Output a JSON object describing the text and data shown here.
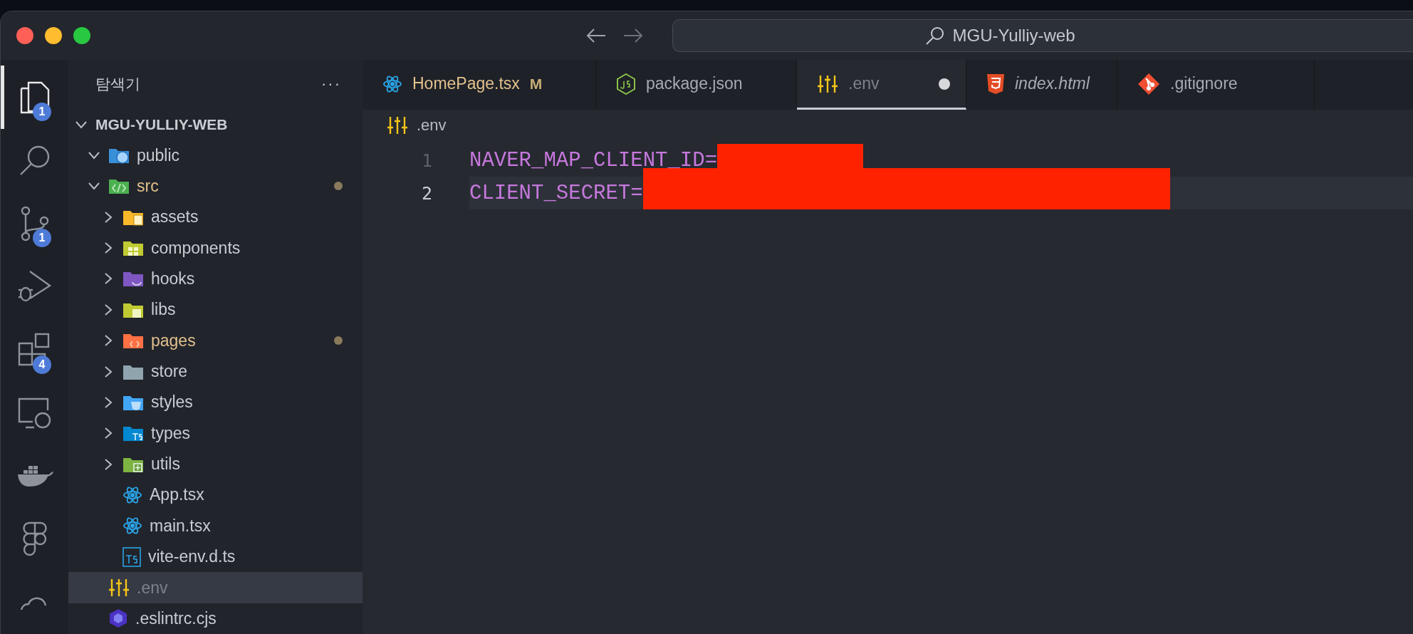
{
  "window": {
    "title": "MGU-Yulliy-web"
  },
  "activity_bar": [
    {
      "kind": "files",
      "selected": true,
      "badge": "1"
    },
    {
      "kind": "search",
      "selected": false
    },
    {
      "kind": "git",
      "selected": false,
      "badge": "1"
    },
    {
      "kind": "debug",
      "selected": false
    },
    {
      "kind": "extensions",
      "selected": false,
      "badge": "4"
    },
    {
      "kind": "remote",
      "selected": false
    },
    {
      "kind": "docker",
      "selected": false
    },
    {
      "kind": "figma",
      "selected": false
    },
    {
      "kind": "cloud",
      "selected": false
    }
  ],
  "sidebar": {
    "title": "탐색기",
    "more": "···",
    "root": {
      "label": "MGU-YULLIY-WEB",
      "expanded": true
    },
    "items": [
      {
        "label": "public",
        "kind": "folder-web",
        "expanded": true,
        "modified": false,
        "selected": false
      },
      {
        "label": "src",
        "kind": "folder-src",
        "expanded": true,
        "modified": true,
        "selected": false,
        "children": [
          {
            "label": "assets",
            "kind": "folder-assets",
            "expanded": false,
            "modified": false,
            "selected": false
          },
          {
            "label": "components",
            "kind": "folder-components",
            "expanded": false,
            "modified": false,
            "selected": false
          },
          {
            "label": "hooks",
            "kind": "folder-hooks",
            "expanded": false,
            "modified": false,
            "selected": false
          },
          {
            "label": "libs",
            "kind": "folder-libs",
            "expanded": false,
            "modified": false,
            "selected": false
          },
          {
            "label": "pages",
            "kind": "folder-pages",
            "expanded": false,
            "modified": true,
            "selected": false
          },
          {
            "label": "store",
            "kind": "folder-store",
            "expanded": false,
            "modified": false,
            "selected": false
          },
          {
            "label": "styles",
            "kind": "folder-styles",
            "expanded": false,
            "modified": false,
            "selected": false
          },
          {
            "label": "types",
            "kind": "folder-types",
            "expanded": false,
            "modified": false,
            "selected": false
          },
          {
            "label": "utils",
            "kind": "folder-utils",
            "expanded": false,
            "modified": false,
            "selected": false
          },
          {
            "label": "App.tsx",
            "kind": "react",
            "modified": false,
            "selected": false
          },
          {
            "label": "main.tsx",
            "kind": "react",
            "modified": false,
            "selected": false
          },
          {
            "label": "vite-env.d.ts",
            "kind": "ts",
            "modified": false,
            "selected": false
          }
        ]
      },
      {
        "label": ".env",
        "kind": "env",
        "modified": false,
        "ignored": true,
        "selected": true
      },
      {
        "label": ".eslintrc.cjs",
        "kind": "eslint",
        "modified": false,
        "selected": false
      }
    ]
  },
  "tabs": [
    {
      "label": "HomePage.tsx",
      "kind": "react",
      "status": "M",
      "selected": false,
      "dirty": false,
      "preview": false,
      "ignored": false
    },
    {
      "label": "package.json",
      "kind": "json",
      "selected": false,
      "dirty": false,
      "preview": false,
      "ignored": false
    },
    {
      "label": ".env",
      "kind": "env",
      "selected": true,
      "dirty": true,
      "preview": false,
      "ignored": true
    },
    {
      "label": "index.html",
      "kind": "html",
      "selected": false,
      "dirty": false,
      "preview": true,
      "ignored": false
    },
    {
      "label": ".gitignore",
      "kind": "git",
      "selected": false,
      "dirty": false,
      "preview": false,
      "ignored": false
    }
  ],
  "breadcrumb": {
    "label": ".env",
    "kind": "env"
  },
  "editor": {
    "lines": [
      {
        "number": "1",
        "text": "NAVER_MAP_CLIENT_ID=",
        "redacted": true,
        "active": false
      },
      {
        "number": "2",
        "text": "CLIENT_SECRET=",
        "redacted": true,
        "active": true
      }
    ]
  }
}
